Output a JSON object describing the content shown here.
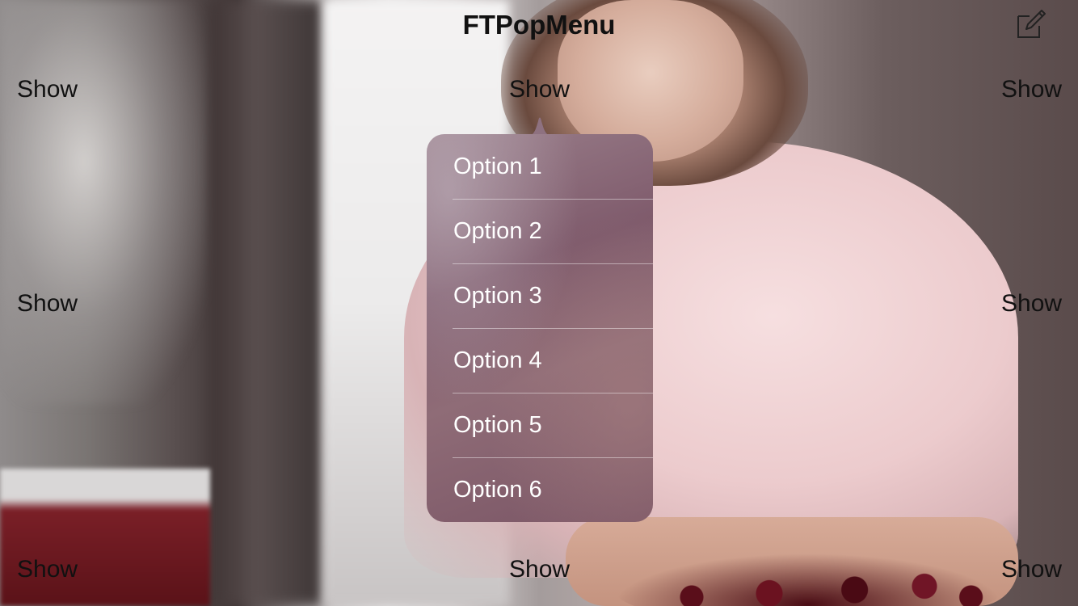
{
  "nav": {
    "title": "FTPopMenu",
    "compose_icon": "compose-icon"
  },
  "show_buttons": {
    "top_left": "Show",
    "top_center": "Show",
    "top_right": "Show",
    "middle_left": "Show",
    "middle_right": "Show",
    "bottom_left": "Show",
    "bottom_center": "Show",
    "bottom_right": "Show"
  },
  "popup_menu": {
    "items": [
      {
        "label": "Option 1"
      },
      {
        "label": "Option 2"
      },
      {
        "label": "Option 3"
      },
      {
        "label": "Option 4"
      },
      {
        "label": "Option 5"
      },
      {
        "label": "Option 6"
      }
    ]
  },
  "colors": {
    "text": "#111111",
    "menu_text": "#ffffff",
    "menu_tint": "#8a6878"
  }
}
